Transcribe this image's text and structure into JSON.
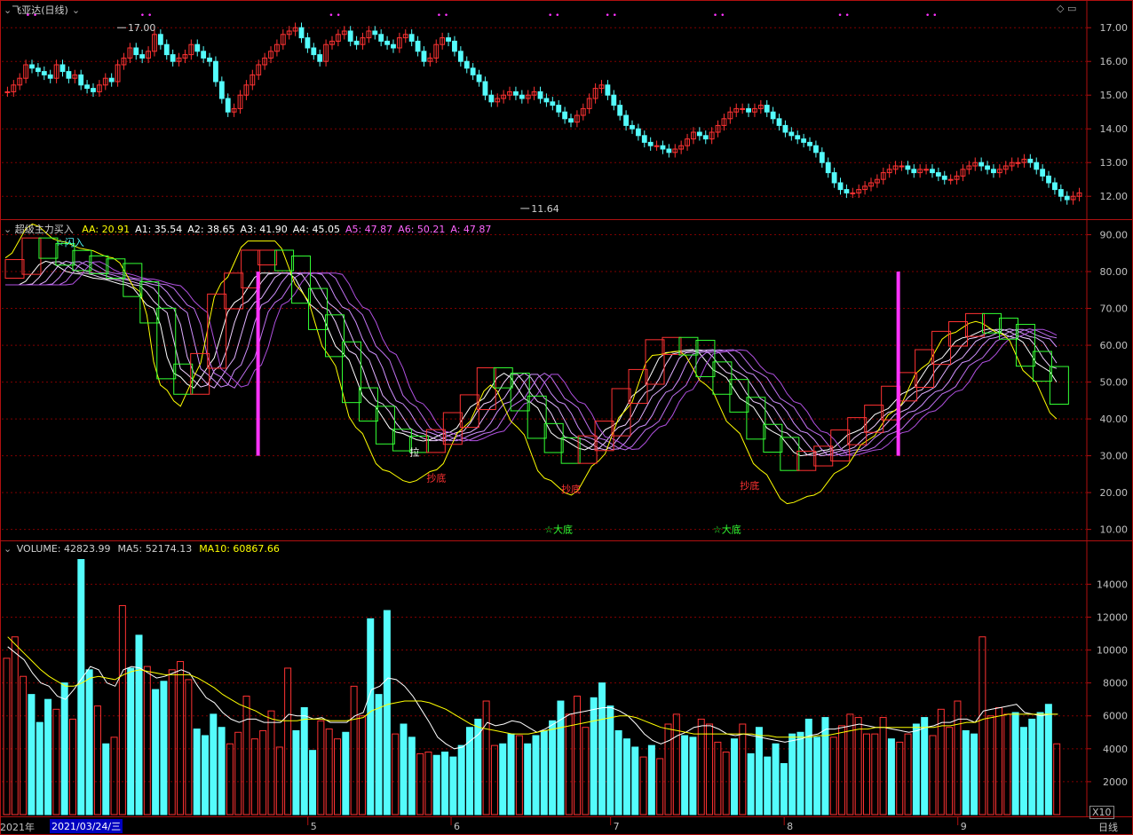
{
  "header": {
    "stock_title": "飞亚达(日线)",
    "period_label": "日线",
    "zoom_label": "X10",
    "date_start_partial": "2021年",
    "cursor_date": "2021/03/24/三"
  },
  "colors": {
    "up": "#ff3232",
    "down": "#54fcfc",
    "grid": "#800000",
    "axis": "#b01010",
    "yellow": "#ffff00",
    "magenta": "#ff33ff",
    "green": "#33ff33"
  },
  "chart_data": [
    {
      "type": "candlestick",
      "title": "飞亚达(日线)",
      "ylim": [
        11.4,
        17.4
      ],
      "yticks": [
        "17.00",
        "16.00",
        "15.00",
        "14.00",
        "13.00",
        "12.00"
      ],
      "annotations": [
        {
          "text": "17.00",
          "kind": "high",
          "x_index": 24
        },
        {
          "text": "11.64",
          "kind": "low",
          "x_index": 113
        }
      ],
      "x_labels": [
        "5",
        "6",
        "7",
        "8",
        "9"
      ],
      "closes": [
        15.1,
        15.3,
        15.5,
        15.9,
        15.8,
        15.7,
        15.6,
        15.5,
        15.9,
        15.7,
        15.5,
        15.6,
        15.3,
        15.2,
        15.1,
        15.3,
        15.5,
        15.4,
        15.9,
        16.1,
        16.4,
        16.2,
        16.1,
        16.3,
        16.8,
        16.5,
        16.2,
        16.0,
        16.1,
        16.2,
        16.5,
        16.3,
        16.1,
        16.0,
        15.4,
        14.9,
        14.5,
        14.6,
        15.0,
        15.3,
        15.6,
        15.9,
        16.1,
        16.3,
        16.5,
        16.8,
        16.9,
        17.0,
        16.7,
        16.4,
        16.2,
        16.0,
        16.5,
        16.6,
        16.8,
        16.9,
        16.6,
        16.5,
        16.7,
        16.9,
        16.8,
        16.6,
        16.5,
        16.4,
        16.7,
        16.8,
        16.6,
        16.3,
        16.0,
        16.1,
        16.5,
        16.7,
        16.6,
        16.3,
        16.0,
        15.8,
        15.6,
        15.4,
        15.0,
        14.8,
        14.9,
        15.0,
        15.1,
        15.0,
        14.9,
        15.0,
        15.1,
        14.9,
        14.8,
        14.7,
        14.5,
        14.3,
        14.2,
        14.4,
        14.6,
        14.9,
        15.2,
        15.3,
        15.0,
        14.7,
        14.4,
        14.1,
        14.0,
        13.8,
        13.6,
        13.5,
        13.5,
        13.4,
        13.3,
        13.4,
        13.5,
        13.7,
        13.9,
        13.8,
        13.7,
        13.9,
        14.1,
        14.3,
        14.5,
        14.6,
        14.6,
        14.5,
        14.6,
        14.7,
        14.5,
        14.3,
        14.1,
        13.9,
        13.8,
        13.7,
        13.6,
        13.5,
        13.3,
        13.0,
        12.7,
        12.4,
        12.2,
        12.1,
        12.1,
        12.2,
        12.3,
        12.4,
        12.5,
        12.7,
        12.8,
        12.9,
        12.9,
        12.8,
        12.7,
        12.8,
        12.8,
        12.7,
        12.6,
        12.5,
        12.5,
        12.6,
        12.8,
        12.9,
        13.0,
        12.9,
        12.8,
        12.7,
        12.8,
        12.9,
        13.0,
        13.0,
        13.1,
        13.0,
        12.8,
        12.6,
        12.4,
        12.2,
        12.0,
        11.9,
        12.0,
        12.1
      ]
    },
    {
      "type": "line",
      "title": "超级主力买入",
      "ylim": [
        7.5,
        93.5
      ],
      "yticks": [
        "90.00",
        "80.00",
        "70.00",
        "60.00",
        "50.00",
        "40.00",
        "30.00",
        "20.00",
        "10.00"
      ],
      "series": [
        {
          "name": "AA",
          "value": "20.91"
        },
        {
          "name": "A1",
          "value": "35.54"
        },
        {
          "name": "A2",
          "value": "38.65"
        },
        {
          "name": "A3",
          "value": "41.90"
        },
        {
          "name": "A4",
          "value": "45.05"
        },
        {
          "name": "A5",
          "value": "47.87"
        },
        {
          "name": "A6",
          "value": "50.21"
        },
        {
          "name": "A",
          "value": "47.87"
        }
      ],
      "legend": "top-left",
      "annotations": [
        "☆闪入",
        "拉",
        "抄底",
        "☆大底",
        "☆大底",
        "抄底",
        "抄底"
      ],
      "anchors": [
        [
          0,
          78
        ],
        [
          8,
          86
        ],
        [
          16,
          82
        ],
        [
          24,
          80
        ],
        [
          32,
          78
        ],
        [
          40,
          70
        ],
        [
          46,
          48
        ],
        [
          52,
          43
        ],
        [
          56,
          50
        ],
        [
          64,
          72
        ],
        [
          72,
          82
        ],
        [
          80,
          82
        ],
        [
          88,
          70
        ],
        [
          96,
          55
        ],
        [
          104,
          38
        ],
        [
          112,
          28
        ],
        [
          120,
          25
        ],
        [
          128,
          28
        ],
        [
          136,
          38
        ],
        [
          144,
          48
        ],
        [
          152,
          38
        ],
        [
          160,
          26
        ],
        [
          168,
          22
        ],
        [
          176,
          30
        ],
        [
          184,
          42
        ],
        [
          192,
          55
        ],
        [
          200,
          56
        ],
        [
          208,
          48
        ],
        [
          216,
          38
        ],
        [
          224,
          28
        ],
        [
          232,
          20
        ],
        [
          240,
          22
        ],
        [
          248,
          28
        ],
        [
          256,
          35
        ],
        [
          264,
          42
        ],
        [
          272,
          52
        ],
        [
          280,
          60
        ],
        [
          288,
          63
        ],
        [
          296,
          60
        ],
        [
          304,
          50
        ],
        [
          312,
          40
        ]
      ]
    },
    {
      "type": "bar",
      "title": "VOLUME",
      "ylim": [
        0,
        16500
      ],
      "yticks": [
        "14000",
        "12000",
        "10000",
        "8000",
        "6000",
        "4000",
        "2000"
      ],
      "series": [
        {
          "name": "VOLUME",
          "value": "42823.99"
        },
        {
          "name": "MA5",
          "value": "52174.13"
        },
        {
          "name": "MA10",
          "value": "60867.66"
        }
      ],
      "values": [
        9500,
        10800,
        8400,
        7300,
        5600,
        7000,
        6400,
        8000,
        5800,
        15500,
        8800,
        6600,
        4300,
        4700,
        12700,
        8900,
        10900,
        9000,
        7600,
        8100,
        8800,
        9300,
        8200,
        5200,
        4800,
        6100,
        5300,
        4300,
        5000,
        7200,
        4600,
        5100,
        6300,
        4100,
        8900,
        5100,
        6500,
        3900,
        5700,
        5200,
        4600,
        5000,
        7800,
        6000,
        11900,
        7300,
        12400,
        4900,
        5500,
        4700,
        3700,
        3800,
        3600,
        3800,
        3500,
        4200,
        5300,
        5800,
        6900,
        4200,
        4300,
        4900,
        4800,
        4300,
        4800,
        5100,
        5700,
        6900,
        6100,
        7200,
        5300,
        7100,
        8000,
        6600,
        5100,
        4600,
        4100,
        3500,
        4200,
        3400,
        5500,
        6100,
        4800,
        4700,
        5800,
        5500,
        4400,
        3800,
        4600,
        5500,
        3700,
        5300,
        3500,
        4300,
        3100,
        4900,
        5000,
        5800,
        4700,
        5900,
        4700,
        5400,
        6100,
        5900,
        4900,
        4900,
        5900,
        4600,
        4400,
        4900,
        5500,
        5900,
        4800,
        6400,
        5300,
        6900,
        5100,
        4900,
        10800,
        6000,
        6500,
        6100,
        6200,
        5300,
        5800,
        6200,
        6700,
        4300
      ],
      "ma5": [
        10200,
        9800,
        9400,
        8600,
        8000,
        7800,
        7200,
        7000,
        7600,
        8300,
        9000,
        8800,
        8000,
        7800,
        8800,
        9000,
        8900,
        8600,
        8300,
        8400,
        8600,
        8800,
        8600,
        7800,
        7100,
        6800,
        6200,
        5800,
        5600,
        5800,
        5800,
        5600,
        5600,
        5600,
        6100,
        6000,
        6000,
        5800,
        5900,
        5600,
        5600,
        5600,
        6000,
        6200,
        7600,
        7800,
        8300,
        8200,
        7800,
        7200,
        6400,
        5600,
        4700,
        4300,
        4000,
        4100,
        4500,
        4900,
        5600,
        5400,
        5500,
        5700,
        5600,
        5300,
        5000,
        5200,
        5500,
        5800,
        6100,
        6200,
        6300,
        6400,
        6500,
        6500,
        6300,
        6000,
        5500,
        4900,
        4500,
        4300,
        4500,
        4800,
        5000,
        5300,
        5400,
        5400,
        5200,
        4900,
        4800,
        4900,
        4800,
        4700,
        4600,
        4500,
        4400,
        4500,
        4600,
        4800,
        4900,
        5200,
        5200,
        5300,
        5400,
        5500,
        5400,
        5300,
        5300,
        5200,
        5100,
        5000,
        5100,
        5300,
        5400,
        5600,
        5600,
        5800,
        5800,
        5600,
        6300,
        6400,
        6500,
        6600,
        6700,
        6200,
        6100,
        6000,
        6100,
        6100
      ],
      "ma10": [
        10800,
        10300,
        9800,
        9300,
        8800,
        8400,
        8100,
        7800,
        7800,
        8000,
        8300,
        8400,
        8300,
        8200,
        8500,
        8700,
        8800,
        8700,
        8600,
        8500,
        8500,
        8500,
        8500,
        8300,
        8000,
        7700,
        7300,
        7000,
        6700,
        6500,
        6300,
        6000,
        5800,
        5700,
        5700,
        5700,
        5800,
        5800,
        5800,
        5700,
        5700,
        5700,
        5800,
        5900,
        6300,
        6500,
        6700,
        6800,
        6900,
        6900,
        6900,
        6800,
        6600,
        6400,
        6100,
        5800,
        5500,
        5300,
        5200,
        5100,
        5000,
        4900,
        4900,
        4900,
        5000,
        5100,
        5200,
        5300,
        5400,
        5500,
        5600,
        5700,
        5800,
        5900,
        6000,
        6000,
        5900,
        5700,
        5500,
        5300,
        5200,
        5100,
        5000,
        4900,
        4900,
        4900,
        4900,
        4900,
        4900,
        4900,
        4900,
        4800,
        4800,
        4700,
        4700,
        4700,
        4700,
        4700,
        4800,
        4800,
        4900,
        5000,
        5100,
        5200,
        5200,
        5300,
        5300,
        5300,
        5300,
        5300,
        5300,
        5300,
        5300,
        5400,
        5400,
        5500,
        5600,
        5600,
        5800,
        5900,
        6000,
        6100,
        6100,
        6100,
        6100,
        6100,
        6100,
        6100
      ]
    }
  ]
}
